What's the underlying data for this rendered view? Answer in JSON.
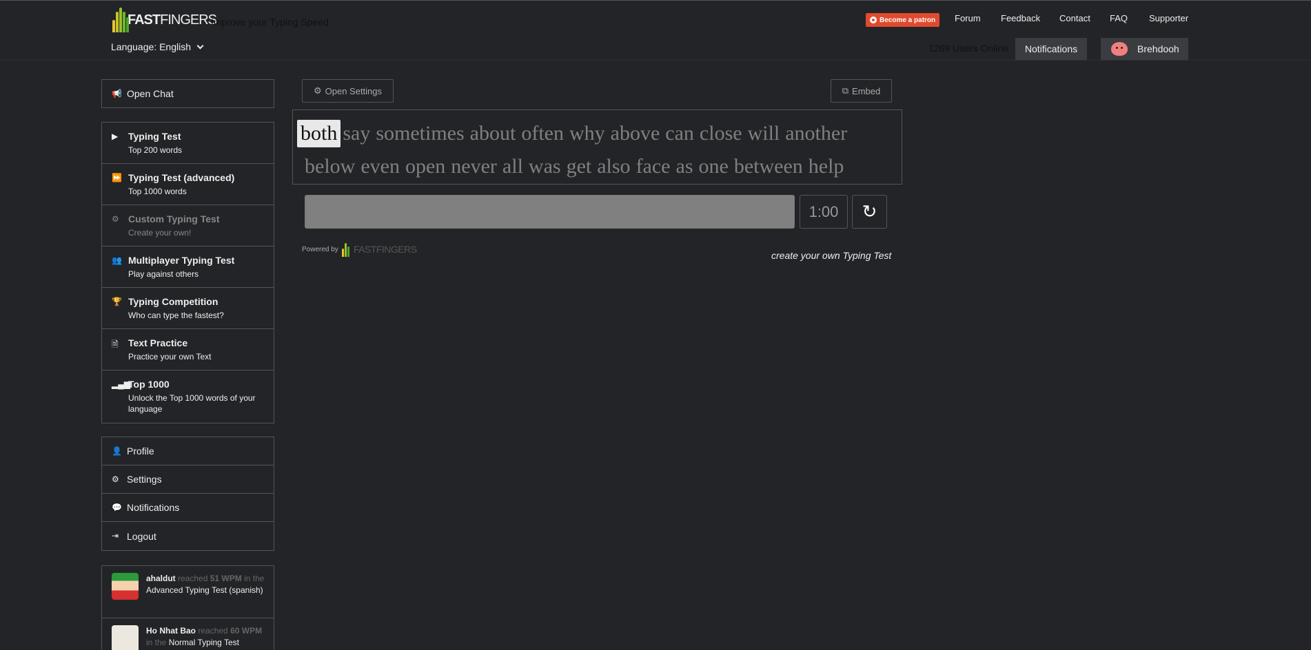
{
  "header": {
    "logo_text_bold": "FAST",
    "logo_text": "FINGERS",
    "tagline": "Improve your Typing Speed",
    "language_label": "Language: English",
    "patron_button": "Become a patron",
    "nav": [
      "Forum",
      "Feedback",
      "Contact",
      "FAQ",
      "Supporter"
    ],
    "users_online": "1269 Users Online",
    "notifications_button": "Notifications",
    "username": "Brehdooh"
  },
  "sidebar": {
    "chat": "Open Chat",
    "games": [
      {
        "title": "Typing Test",
        "sub": "Top 200 words",
        "icon": "play-icon"
      },
      {
        "title": "Typing Test (advanced)",
        "sub": "Top 1000 words",
        "icon": "fast-forward-icon"
      },
      {
        "title": "Custom Typing Test",
        "sub": "Create your own!",
        "icon": "gears-icon"
      },
      {
        "title": "Multiplayer Typing Test",
        "sub": "Play against others",
        "icon": "users-icon"
      },
      {
        "title": "Typing Competition",
        "sub": "Who can type the fastest?",
        "icon": "trophy-icon"
      },
      {
        "title": "Text Practice",
        "sub": "Practice your own Text",
        "icon": "document-icon"
      },
      {
        "title": "Top 1000",
        "sub": "Unlock the Top 1000 words of your language",
        "icon": "signal-icon"
      }
    ],
    "account": [
      "Profile",
      "Settings",
      "Notifications",
      "Logout"
    ],
    "feed": [
      {
        "name": "ahaldut",
        "verb": "reached",
        "wpm": "51 WPM",
        "mid": "in the",
        "test": "Advanced Typing Test (spanish)"
      },
      {
        "name": "Ho Nhat Bao",
        "verb": "reached",
        "wpm": "60 WPM",
        "mid": "in the",
        "test": "Normal Typing Test (vietnamese)"
      }
    ]
  },
  "main": {
    "open_settings": "Open Settings",
    "embed": "Embed",
    "current_word": "both",
    "words_line1": [
      "say",
      "sometimes",
      "about",
      "often",
      "why",
      "above",
      "can",
      "close",
      "will",
      "another"
    ],
    "words_line2": [
      "below",
      "even",
      "open",
      "never",
      "all",
      "was",
      "get",
      "also",
      "face",
      "as",
      "one",
      "between",
      "help"
    ],
    "timer": "1:00",
    "reload_glyph": "↻",
    "powered_by": "Powered by",
    "powered_logo": "FASTFINGERS",
    "create_link": "create your own Typing Test"
  }
}
